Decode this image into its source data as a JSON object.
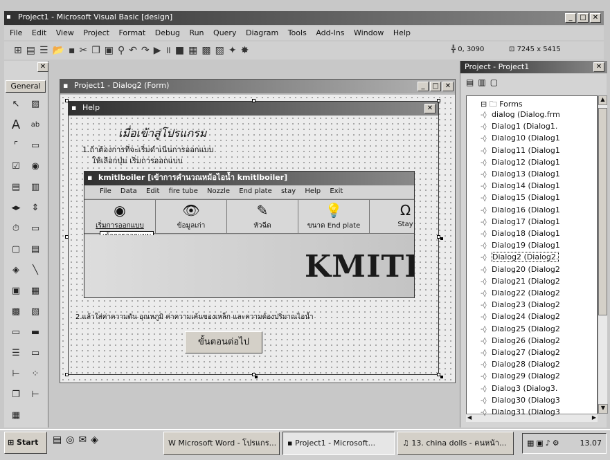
{
  "window": {
    "title": "Project1 - Microsoft Visual Basic [design]"
  },
  "menu": [
    "File",
    "Edit",
    "View",
    "Project",
    "Format",
    "Debug",
    "Run",
    "Query",
    "Diagram",
    "Tools",
    "Add-Ins",
    "Window",
    "Help"
  ],
  "toolbar": {
    "position": "0, 3090",
    "size": "7245 x 5415"
  },
  "toolbox": {
    "title": "General"
  },
  "form_window": {
    "title": "Project1 - Dialog2 (Form)"
  },
  "help_form": {
    "title": "Help",
    "heading": "เมื่อเข้าสู่โปรแกรม",
    "step1": "1.ถ้าต้องการที่จะเริ่มดำเนินการออกแบบ",
    "step1_sub": "ให้เลือกปุ่ม    เริ่มการออกแบบ",
    "step2": "2.แล้วใส่ค่าความดัน อุณหภูมิ ค่าความเค้นของเหล็ก และความต้องปริมาณไอน้ำ",
    "next_button": "ขั้นตอนต่อไป"
  },
  "kmitl": {
    "title": "kmitlboiler    [เข้าการคำนวณหม้อไอน้ำ  kmitlboiler]",
    "menu": [
      "File",
      "Data",
      "Edit",
      "fire tube",
      "Nozzle",
      "End plate",
      "stay",
      "Help",
      "Exit"
    ],
    "buttons": [
      {
        "label": "เริ่มการออกแบบ",
        "icon": "◉"
      },
      {
        "label": "ข้อมูลเก่า",
        "icon": "👁"
      },
      {
        "label": "หัวฉีด",
        "icon": "✎"
      },
      {
        "label": "ขนาด End plate",
        "icon": "💡"
      },
      {
        "label": "Stay",
        "icon": "Ω"
      }
    ],
    "tooltip": "เข้าการออกแบบ",
    "banner": "KMITL"
  },
  "project_panel": {
    "title": "Project - Project1",
    "folder": "Forms",
    "items": [
      "dialog (Dialog.frm",
      "Dialog1 (Dialog1.",
      "Dialog10 (Dialog1",
      "Dialog11 (Dialog1",
      "Dialog12 (Dialog1",
      "Dialog13 (Dialog1",
      "Dialog14 (Dialog1",
      "Dialog15 (Dialog1",
      "Dialog16 (Dialog1",
      "Dialog17 (Dialog1",
      "Dialog18 (Dialog1",
      "Dialog19 (Dialog1",
      "Dialog2 (Dialog2.",
      "Dialog20 (Dialog2",
      "Dialog21 (Dialog2",
      "Dialog22 (Dialog2",
      "Dialog23 (Dialog2",
      "Dialog24 (Dialog2",
      "Dialog25 (Dialog2",
      "Dialog26 (Dialog2",
      "Dialog27 (Dialog2",
      "Dialog28 (Dialog2",
      "Dialog29 (Dialog2",
      "Dialog3 (Dialog3.",
      "Dialog30 (Dialog3",
      "Dialog31 (Dialog3"
    ]
  },
  "taskbar": {
    "start": "Start",
    "tasks": [
      "Microsoft Word - โปรแกร...",
      "Project1 - Microsoft...",
      "13. china dolls - คนหน้า..."
    ],
    "clock": "13.07"
  }
}
